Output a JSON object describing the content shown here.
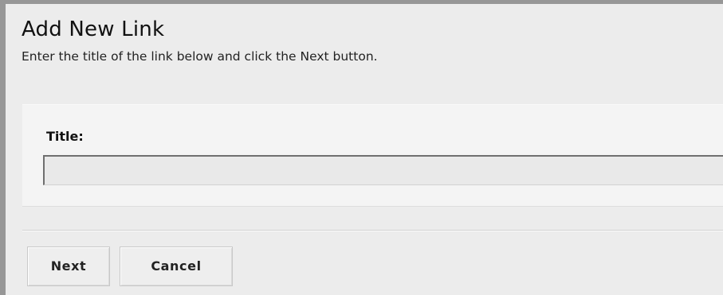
{
  "header": {
    "title": "Add New Link",
    "description": "Enter the title of the link below and click the Next button."
  },
  "form": {
    "title_label": "Title:",
    "title_value": ""
  },
  "actions": {
    "next_label": "Next",
    "cancel_label": "Cancel"
  },
  "colors": {
    "frame_border": "#979797",
    "panel_background": "#ececec",
    "form_panel_background": "#f4f4f4"
  }
}
